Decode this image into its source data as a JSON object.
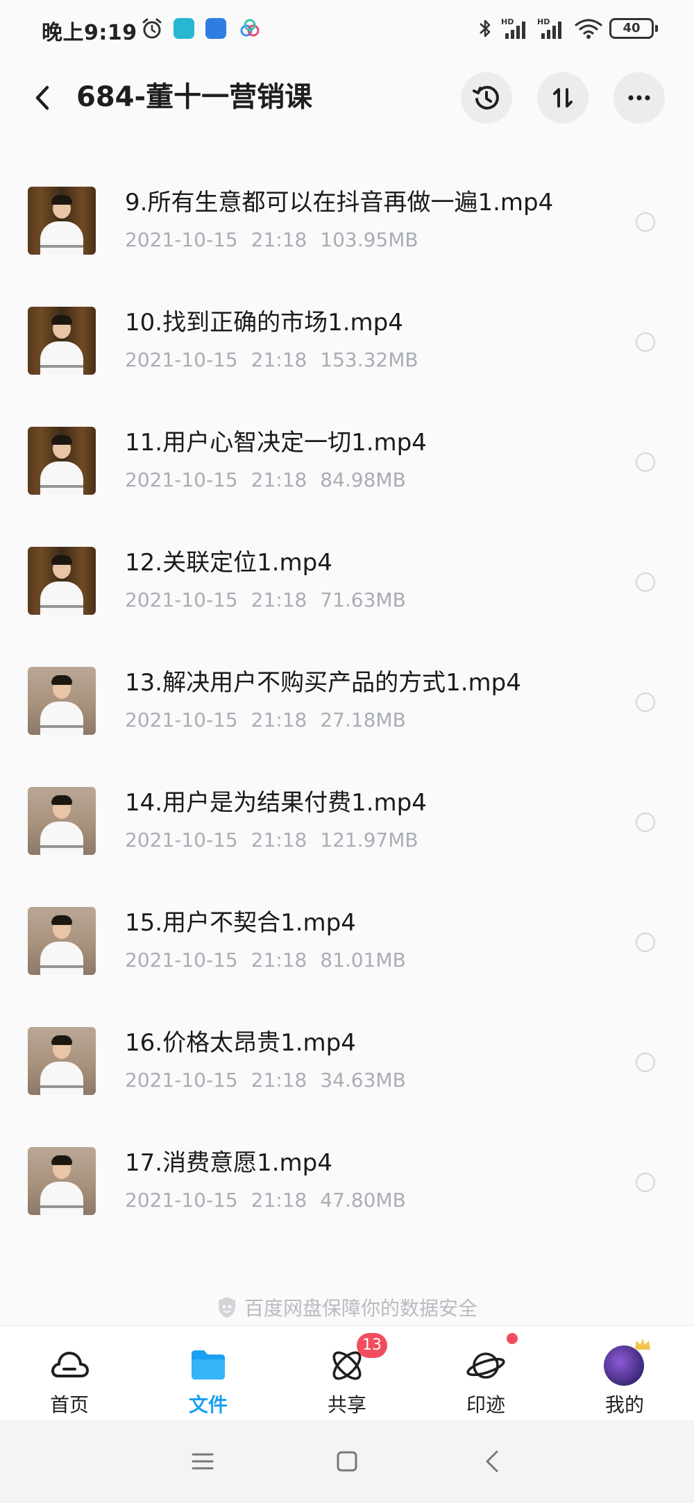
{
  "status_bar": {
    "time": "晚上9:19",
    "battery": "40",
    "icons": [
      "alarm-icon",
      "app-icon",
      "app-icon",
      "cloud-mini-icon",
      "bluetooth-icon",
      "signal-hd-icon",
      "signal-hd-icon",
      "wifi-icon",
      "battery-icon"
    ]
  },
  "header": {
    "title": "684-董十一营销课",
    "back_icon": "chevron-left-icon",
    "history_icon": "history-icon",
    "sort_icon": "sort-icon",
    "more_icon": "more-icon"
  },
  "files": [
    {
      "name": "9.所有生意都可以在抖音再做一遍1.mp4",
      "date": "2021-10-15",
      "time": "21:18",
      "size": "103.95MB",
      "thumb": "dark"
    },
    {
      "name": "10.找到正确的市场1.mp4",
      "date": "2021-10-15",
      "time": "21:18",
      "size": "153.32MB",
      "thumb": "dark"
    },
    {
      "name": "11.用户心智决定一切1.mp4",
      "date": "2021-10-15",
      "time": "21:18",
      "size": "84.98MB",
      "thumb": "dark"
    },
    {
      "name": "12.关联定位1.mp4",
      "date": "2021-10-15",
      "time": "21:18",
      "size": "71.63MB",
      "thumb": "dark"
    },
    {
      "name": "13.解决用户不购买产品的方式1.mp4",
      "date": "2021-10-15",
      "time": "21:18",
      "size": "27.18MB",
      "thumb": "light"
    },
    {
      "name": "14.用户是为结果付费1.mp4",
      "date": "2021-10-15",
      "time": "21:18",
      "size": "121.97MB",
      "thumb": "light"
    },
    {
      "name": "15.用户不契合1.mp4",
      "date": "2021-10-15",
      "time": "21:18",
      "size": "81.01MB",
      "thumb": "light"
    },
    {
      "name": "16.价格太昂贵1.mp4",
      "date": "2021-10-15",
      "time": "21:18",
      "size": "34.63MB",
      "thumb": "light"
    },
    {
      "name": "17.消费意愿1.mp4",
      "date": "2021-10-15",
      "time": "21:18",
      "size": "47.80MB",
      "thumb": "light"
    }
  ],
  "safety_note": "百度网盘保障你的数据安全",
  "tabs": [
    {
      "label": "首页",
      "icon": "cloud-icon",
      "active": false
    },
    {
      "label": "文件",
      "icon": "folder-icon",
      "active": true
    },
    {
      "label": "共享",
      "icon": "share-atom-icon",
      "active": false,
      "badge": "13"
    },
    {
      "label": "印迹",
      "icon": "planet-icon",
      "active": false,
      "dot": true
    },
    {
      "label": "我的",
      "icon": "avatar",
      "active": false
    }
  ],
  "nav": {
    "icons": [
      "menu-icon",
      "home-square-icon",
      "back-triangle-icon"
    ]
  },
  "colors": {
    "accent": "#1aa0f0",
    "badge": "#f24d5e",
    "meta_text": "#a9adb5"
  }
}
